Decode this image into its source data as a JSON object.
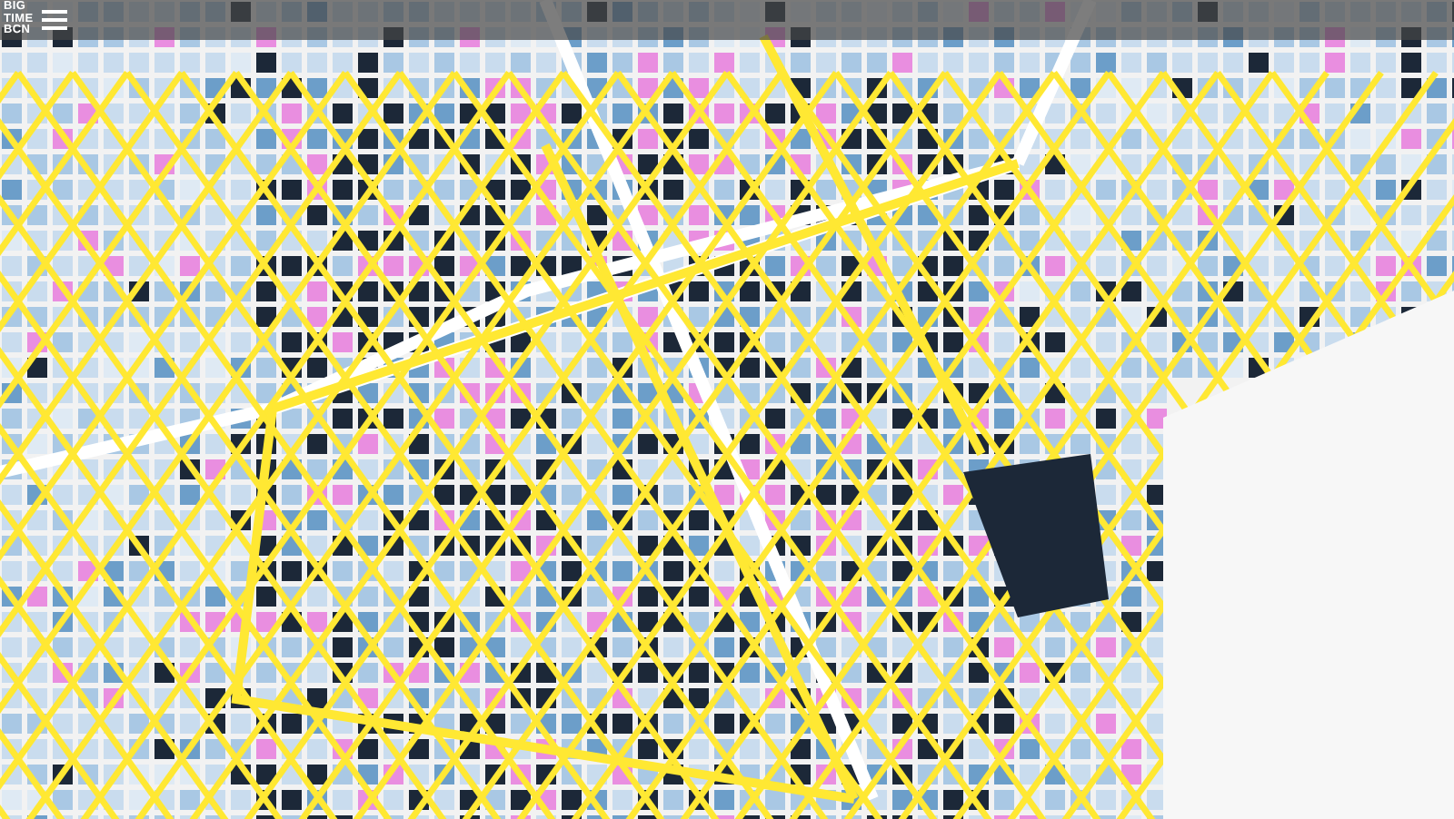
{
  "header": {
    "logo": "BIG\nTIME\nBCN"
  }
}
